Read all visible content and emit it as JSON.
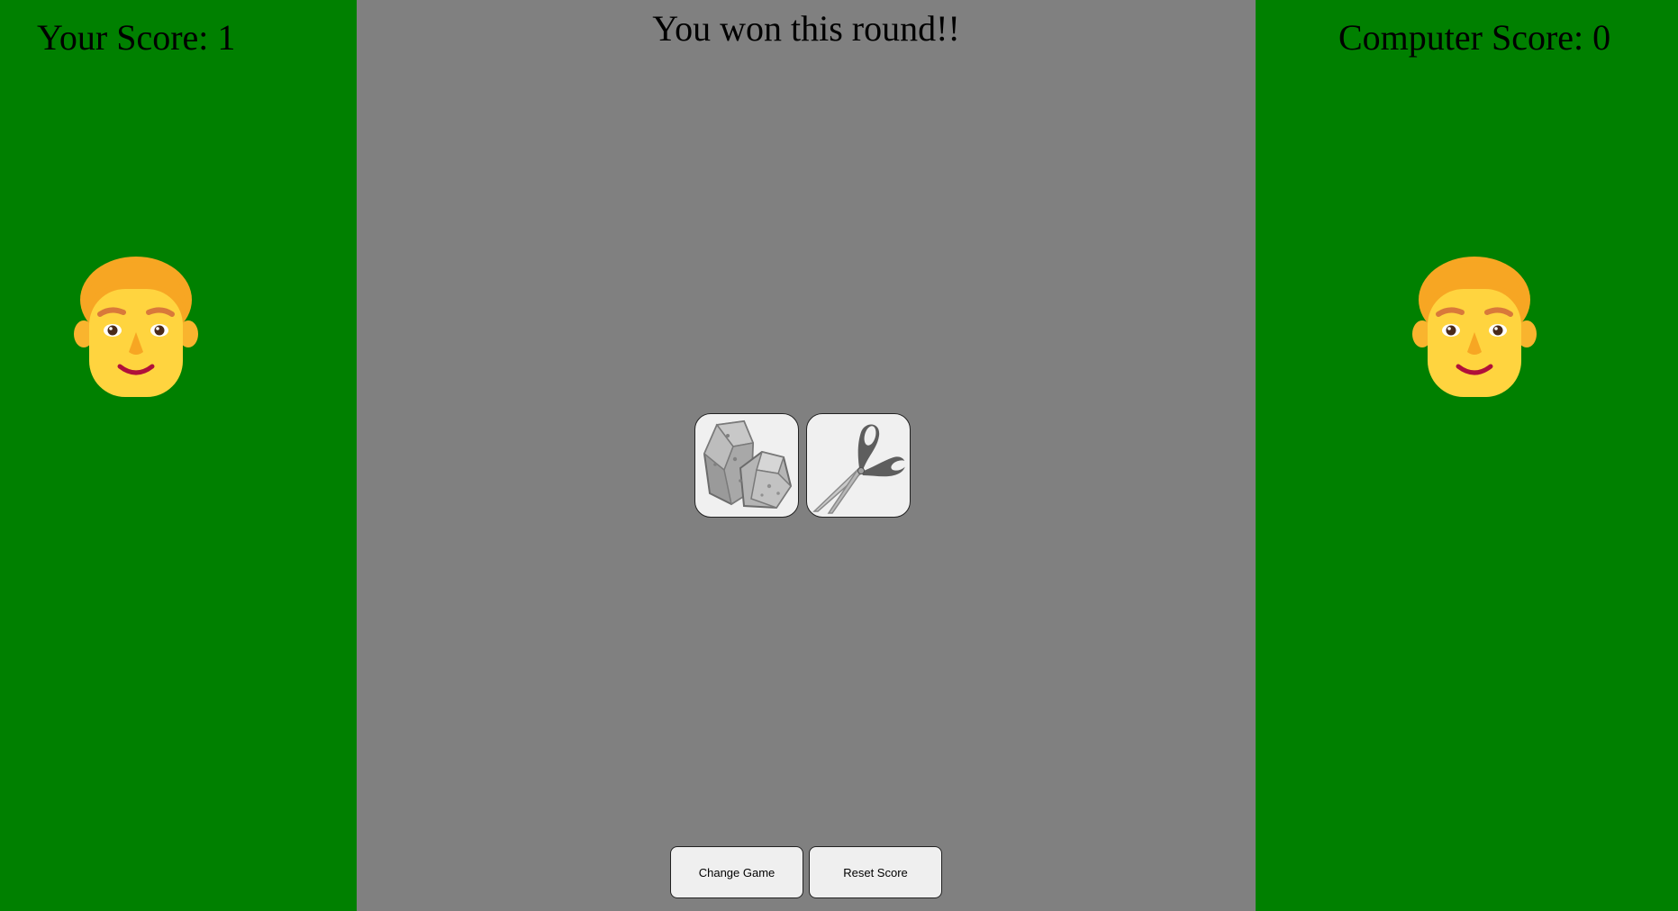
{
  "player": {
    "score_label": "Your Score: 1",
    "score": 1,
    "avatar_icon": "man-face-icon"
  },
  "computer": {
    "score_label": "Computer Score: 0",
    "score": 0,
    "avatar_icon": "man-face-icon"
  },
  "round": {
    "result_text": "You won this round!!",
    "player_choice": "rock-icon",
    "computer_choice": "scissors-icon"
  },
  "controls": {
    "change_game_label": "Change Game",
    "reset_score_label": "Reset Score"
  },
  "colors": {
    "side_panel": "#008000",
    "center_panel": "#808080",
    "button_bg": "#efefef"
  }
}
